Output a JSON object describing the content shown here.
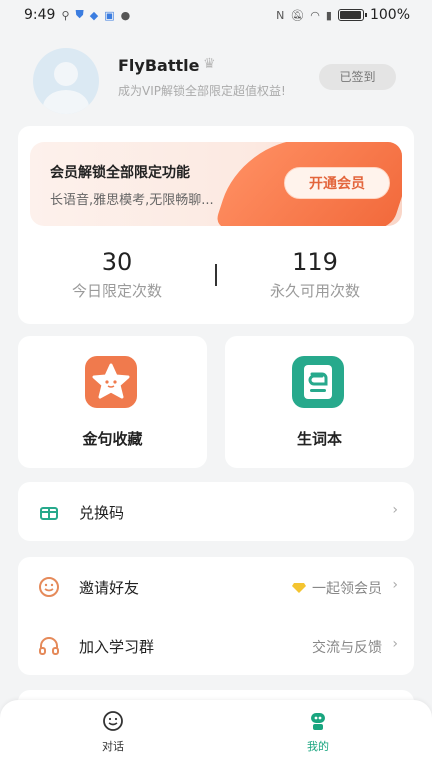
{
  "status_bar": {
    "time": "9:49",
    "battery_text": "100%",
    "battery_level": 1.0
  },
  "profile": {
    "username": "FlyBattle",
    "vip_tip": "成为VIP解锁全部限定超值权益!",
    "checkin_label": "已签到"
  },
  "vip_card": {
    "title": "会员解锁全部限定功能",
    "subtitle": "长语音,雅思模考,无限畅聊...",
    "button_label": "开通会员",
    "accent_color": "#f26a3c",
    "stats": [
      {
        "value": "30",
        "label": "今日限定次数"
      },
      {
        "value": "119",
        "label": "永久可用次数"
      }
    ]
  },
  "features": [
    {
      "label": "金句收藏",
      "icon": "star-icon",
      "color": "#f07a4d"
    },
    {
      "label": "生词本",
      "icon": "notebook-icon",
      "color": "#27a98c"
    }
  ],
  "list": {
    "redeem": {
      "label": "兑换码"
    },
    "invite": {
      "label": "邀请好友",
      "right_text": "一起领会员"
    },
    "join_group": {
      "label": "加入学习群",
      "right_text": "交流与反馈"
    }
  },
  "tabs": [
    {
      "label": "对话",
      "icon": "smile-face-icon"
    },
    {
      "label": "我的",
      "icon": "robot-icon",
      "active": true,
      "color": "#19a57f"
    }
  ]
}
